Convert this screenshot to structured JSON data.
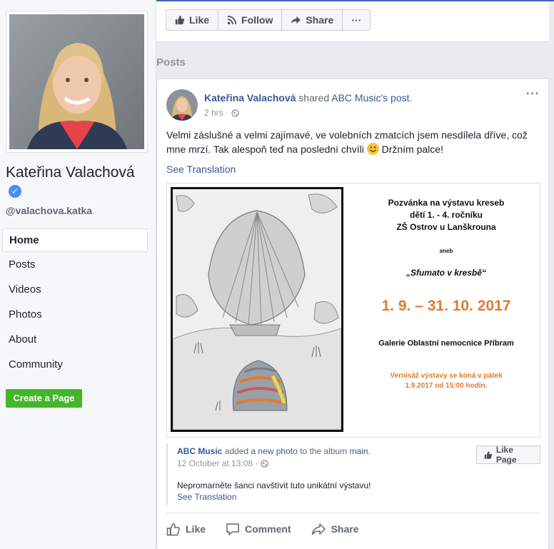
{
  "sidebar": {
    "profile_name": "Kateřina Valachová",
    "username": "@valachova.katka",
    "nav": [
      {
        "label": "Home",
        "active": true
      },
      {
        "label": "Posts"
      },
      {
        "label": "Videos"
      },
      {
        "label": "Photos"
      },
      {
        "label": "About"
      },
      {
        "label": "Community"
      }
    ],
    "create_page_label": "Create a Page",
    "create_page_color": "#42b72a"
  },
  "action_bar": {
    "like_label": "Like",
    "follow_label": "Follow",
    "share_label": "Share",
    "more_label": "···"
  },
  "posts_heading": "Posts",
  "post": {
    "author": "Kateřina Valachová",
    "shared_word": "shared",
    "shared_source": "ABC Music's post.",
    "time": "2 hrs ·",
    "more": "···",
    "text": "Velmi záslušné a velmi zajímavé, ve volebních zmatcích jsem nesdílela dříve, což mne mrzí. Tak alespoň teď na poslední chvíli",
    "text_end": "Držním palce!",
    "see_translation": "See Translation",
    "poster": {
      "title_line1": "Pozvánka na výstavu kreseb",
      "title_line2": "dětí 1. - 4. ročníku",
      "title_line3": "ZŠ Ostrov u Lanškrouna",
      "aneb": "aneb",
      "subtitle": "„Sfumato v kresbě“",
      "dates": "1. 9. – 31. 10. 2017",
      "gallery": "Galerie Oblastní nemocnice Příbram",
      "opening_line1": "Vernisáž výstavy se koná v pátek",
      "opening_line2": "1.9.2017 od 15:00 hodin."
    },
    "shared": {
      "source": "ABC Music",
      "added": "added",
      "a_new_photo": "a new photo",
      "to_the_album": "to the album",
      "album": "main.",
      "time": "12 October at 13:08 ·",
      "text": "Nepromarněte šanci navštívit tuto unikátní výstavu!",
      "see_translation": "See Translation",
      "like_page_label": "Like Page"
    },
    "footer": {
      "like": "Like",
      "comment": "Comment",
      "share": "Share"
    }
  },
  "colors": {
    "link": "#365899",
    "accent": "#4267b2",
    "poster_orange": "#e07b2f"
  }
}
